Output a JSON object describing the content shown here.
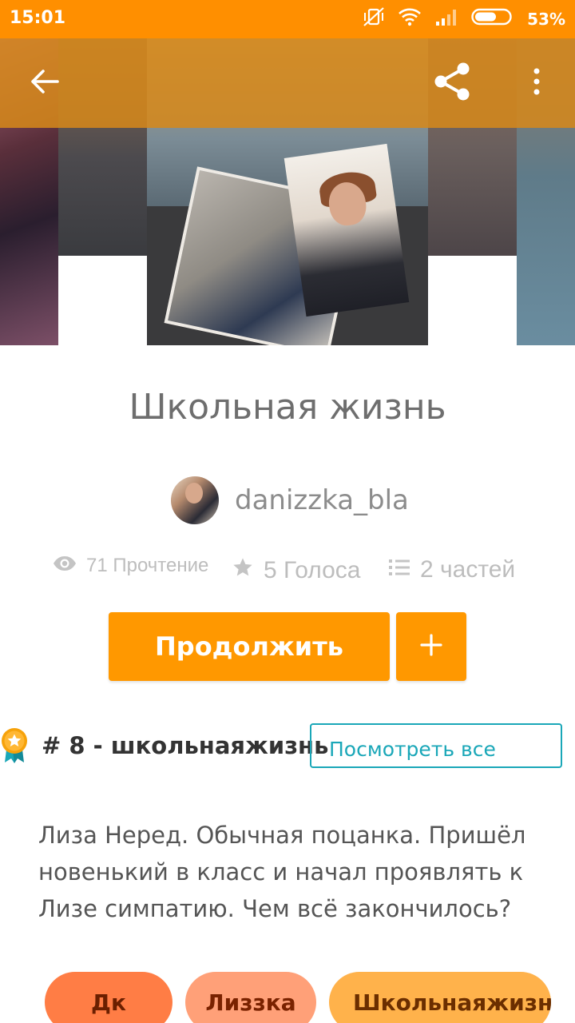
{
  "status_bar": {
    "time": "15:01",
    "battery": "53%"
  },
  "app_bar": {
    "back_icon": "arrow-left-icon",
    "share_icon": "share-icon",
    "more_icon": "more-vertical-icon"
  },
  "story": {
    "title": "Школьная жизнь",
    "author": "danizzka_bla",
    "stats": {
      "reads": "71 Прочтение",
      "votes": "5 Голоса",
      "parts": "2 частей"
    },
    "continue_label": "Продолжить",
    "ranking": {
      "text": "# 8 - школьнаяжизнь",
      "see_all_label": "Посмотреть все"
    },
    "description": "Лиза Неред. Обычная поцанка. Пришёл новенький в класс и начал проявлять к Лизе симпатию. Чем всё закончилось?",
    "tags": [
      "Дк",
      "Лиззка",
      "Школьнаяжизнь"
    ]
  },
  "colors": {
    "status_bar": "#ff8f00",
    "app_bar": "#d6881a",
    "accent": "#ff9800",
    "link": "#1aa7b8"
  }
}
